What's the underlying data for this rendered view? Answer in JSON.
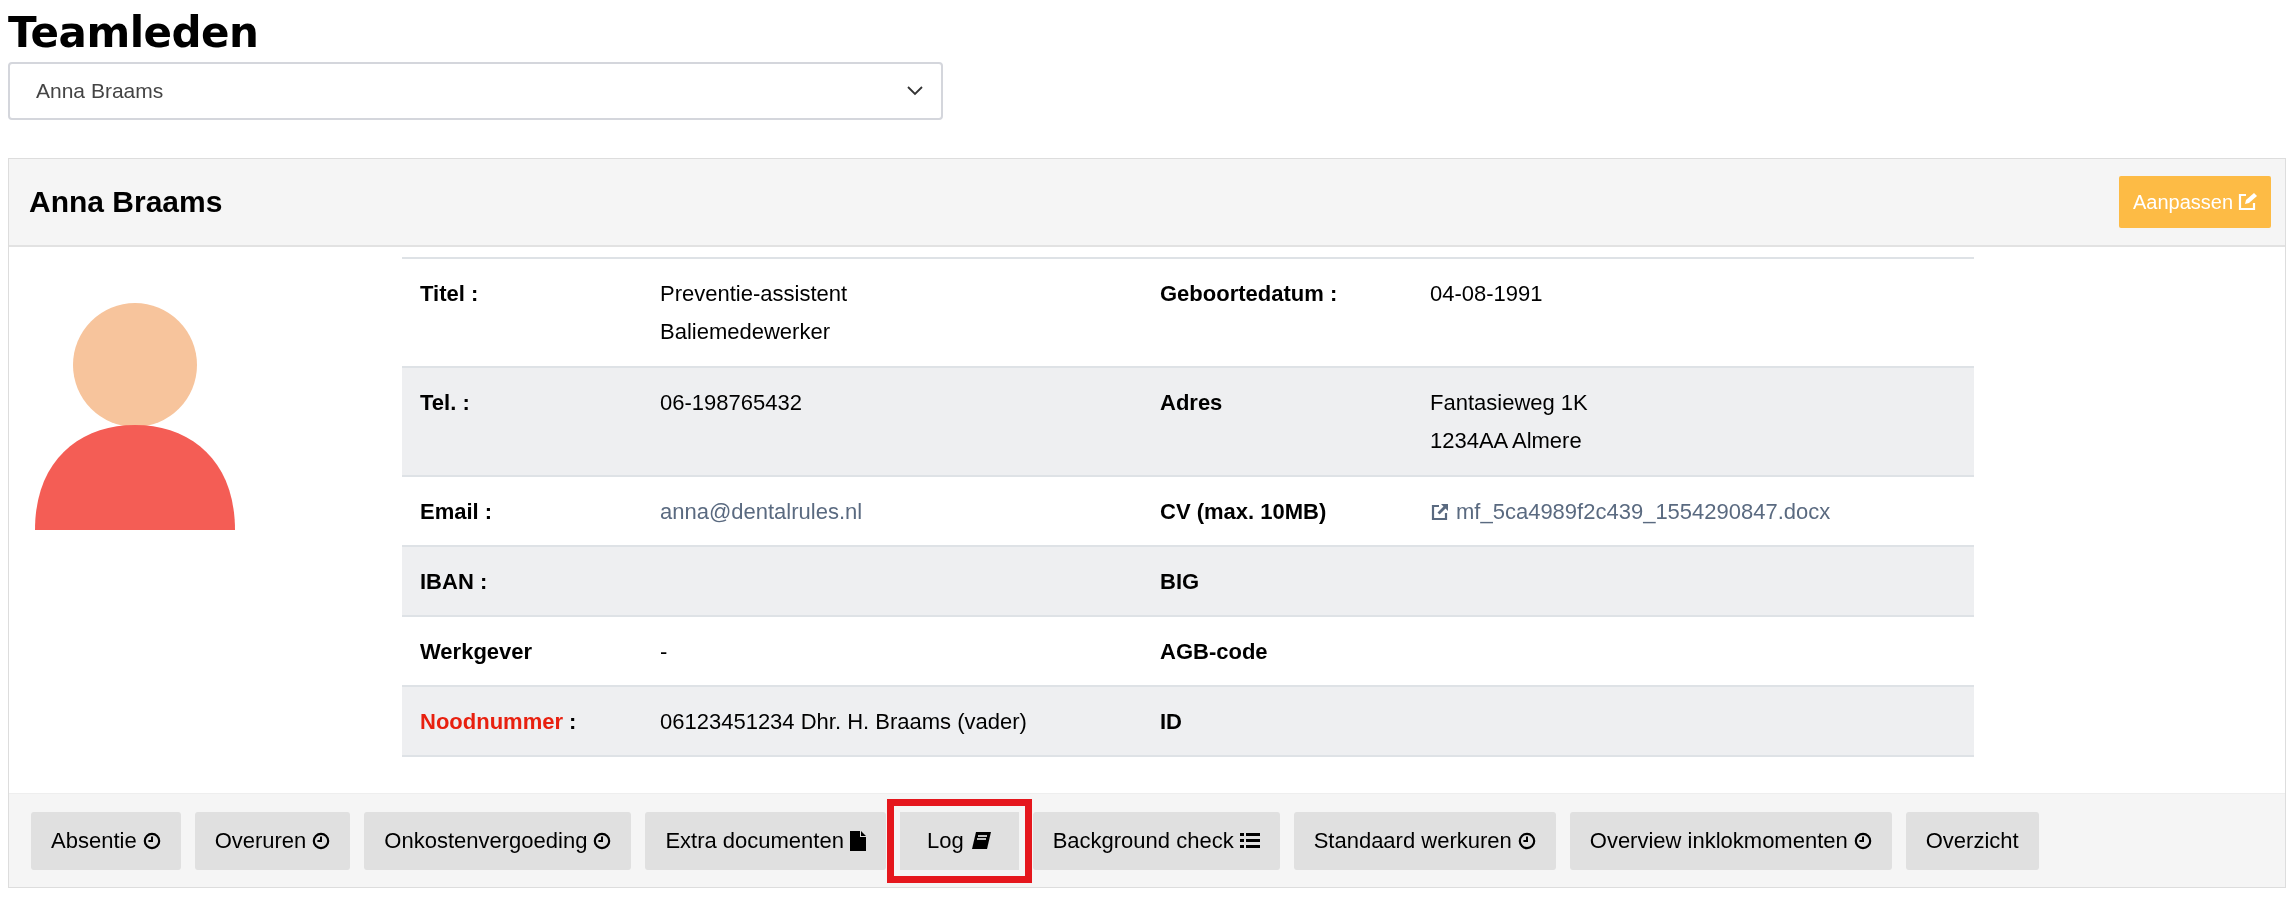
{
  "page_title": "Teamleden",
  "member_select": {
    "value": "Anna Braams"
  },
  "card": {
    "title": "Anna Braams",
    "edit_button": "Aanpassen",
    "rows": [
      {
        "left": {
          "label": "Titel :",
          "lines": [
            "Preventie-assistent",
            "Baliemedewerker"
          ]
        },
        "right": {
          "label": "Geboortedatum :",
          "lines": [
            "04-08-1991"
          ]
        }
      },
      {
        "left": {
          "label": "Tel. :",
          "lines": [
            "06-198765432"
          ]
        },
        "right": {
          "label": "Adres",
          "lines": [
            "Fantasieweg 1K",
            "1234AA Almere"
          ]
        }
      },
      {
        "left": {
          "label": "Email :",
          "kind": "link",
          "lines": [
            "anna@dentalrules.nl"
          ]
        },
        "right": {
          "label": "CV (max. 10MB)",
          "kind": "file_link",
          "lines": [
            "mf_5ca4989f2c439_1554290847.docx"
          ]
        }
      },
      {
        "left": {
          "label": "IBAN :"
        },
        "right": {
          "label": "BIG"
        }
      },
      {
        "left": {
          "label": "Werkgever",
          "lines": [
            "-"
          ]
        },
        "right": {
          "label": "AGB-code"
        }
      },
      {
        "left": {
          "label": "Noodnummer",
          "label_suffix": " :",
          "alert": true,
          "lines": [
            "06123451234 Dhr. H. Braams (vader)"
          ]
        },
        "right": {
          "label": "ID"
        }
      }
    ],
    "buttons": [
      {
        "label": "Absentie",
        "kind": "clock",
        "highlighted": false
      },
      {
        "label": "Overuren",
        "kind": "clock",
        "highlighted": false
      },
      {
        "label": "Onkostenvergoeding",
        "kind": "clock",
        "highlighted": false
      },
      {
        "label": "Extra documenten",
        "kind": "document",
        "highlighted": false
      },
      {
        "label": "Log",
        "kind": "book",
        "highlighted": true
      },
      {
        "label": "Background check",
        "kind": "list",
        "highlighted": false
      },
      {
        "label": "Standaard werkuren",
        "kind": "clock",
        "highlighted": false
      },
      {
        "label": "Overview inklokmomenten",
        "kind": "clock",
        "highlighted": false
      },
      {
        "label": "Overzicht",
        "kind": "plain",
        "highlighted": false
      }
    ]
  }
}
